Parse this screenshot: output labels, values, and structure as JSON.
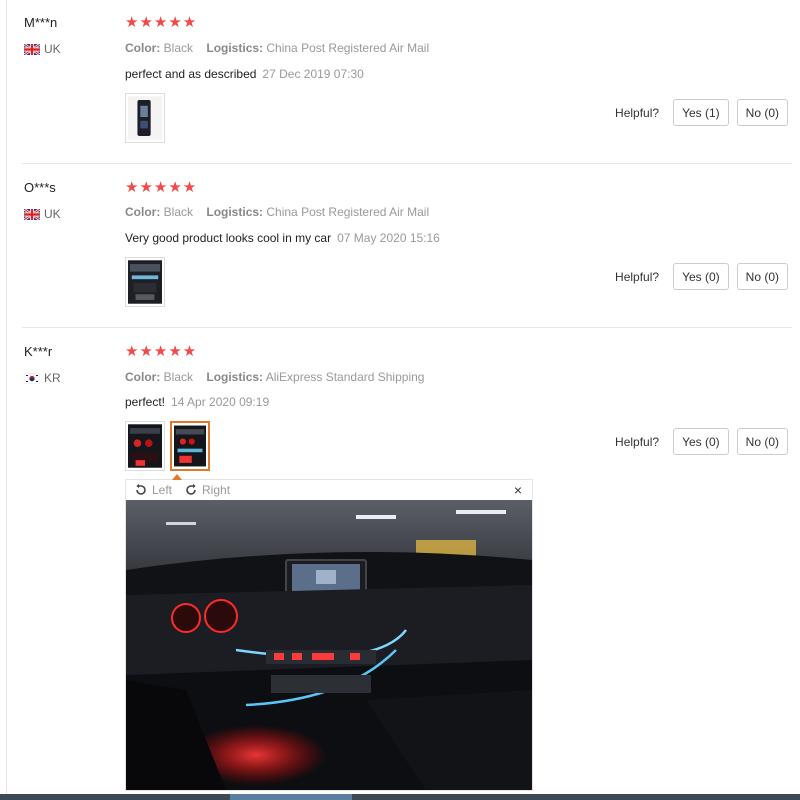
{
  "reviews": [
    {
      "user": "M***n",
      "country_code": "UK",
      "flag": "uk-flag-icon",
      "stars": "★★★★★",
      "rating": 5,
      "color_label": "Color:",
      "color_value": "Black",
      "logistics_label": "Logistics:",
      "logistics_value": "China Post Registered Air Mail",
      "text": "perfect and as described",
      "date": "27 Dec 2019 07:30",
      "helpful_label": "Helpful?",
      "yes_label": "Yes (1)",
      "no_label": "No (0)"
    },
    {
      "user": "O***s",
      "country_code": "UK",
      "flag": "uk-flag-icon",
      "stars": "★★★★★",
      "rating": 5,
      "color_label": "Color:",
      "color_value": "Black",
      "logistics_label": "Logistics:",
      "logistics_value": "China Post Registered Air Mail",
      "text": "Very good product looks cool in my car",
      "date": "07 May 2020 15:16",
      "helpful_label": "Helpful?",
      "yes_label": "Yes (0)",
      "no_label": "No (0)"
    },
    {
      "user": "K***r",
      "country_code": "KR",
      "flag": "kr-flag-icon",
      "stars": "★★★★★",
      "rating": 5,
      "color_label": "Color:",
      "color_value": "Black",
      "logistics_label": "Logistics:",
      "logistics_value": "AliExpress Standard Shipping",
      "text": "perfect!",
      "date": "14 Apr 2020 09:19",
      "helpful_label": "Helpful?",
      "yes_label": "Yes (0)",
      "no_label": "No (0)"
    }
  ],
  "viewer": {
    "rotate_left_label": "Left",
    "rotate_right_label": "Right",
    "close_label": "×",
    "rotate_left_icon": "rotate-left-icon",
    "rotate_right_icon": "rotate-right-icon"
  },
  "colors": {
    "star": "#f04a4a",
    "selected_thumb_border": "#e07a2a",
    "muted_text": "#999999"
  }
}
